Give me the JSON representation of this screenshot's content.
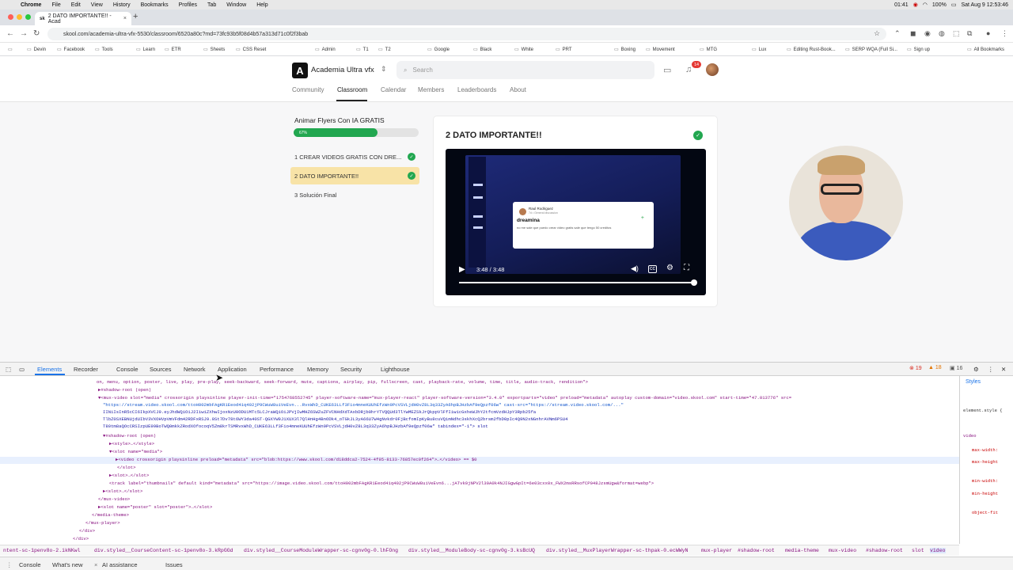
{
  "menubar": {
    "app": "Chrome",
    "items": [
      "File",
      "Edit",
      "View",
      "History",
      "Bookmarks",
      "Profiles",
      "Tab",
      "Window",
      "Help"
    ],
    "clock": "Sat Aug 9  12:53:46",
    "battery": "100%",
    "time_small": "01:41"
  },
  "browser": {
    "tab_title": "2 DATO IMPORTANTE!! - Acad",
    "url": "skool.com/academia-ultra-vfx-5530/classroom/6520a80c?md=73fc93b5f08d4b57a313d71c0f2f3bab",
    "bookmarks": [
      "Devin",
      "Facebook",
      "Tools",
      "Learn",
      "ETR",
      "Sheets",
      "CSS Reset",
      "Admin",
      "T1",
      "T2",
      "Google",
      "Black",
      "White",
      "PRT",
      "Boxing",
      "Movement",
      "MTG",
      "Lux",
      "Editing Rust-Book...",
      "SERP WQA (Full Si...",
      "Sign up",
      "All Bookmarks"
    ]
  },
  "header": {
    "logo_letter": "A",
    "brand": "Academia Ultra vfx",
    "search_placeholder": "Search",
    "notif_count": "14",
    "nav": [
      "Community",
      "Classroom",
      "Calendar",
      "Members",
      "Leaderboards",
      "About"
    ]
  },
  "course": {
    "title": "Animar Flyers Con IA GRATIS",
    "progress_pct": 67,
    "progress_label": "67%",
    "lessons": [
      {
        "label": "1 CREAR VIDEOS GRATIS CON DRE...",
        "done": true
      },
      {
        "label": "2 DATO IMPORTANTE!!",
        "done": true
      },
      {
        "label": "3 Solución Final",
        "done": false
      }
    ]
  },
  "lesson": {
    "title": "2 DATO IMPORTANTE!!",
    "time": "3:48 / 3:48",
    "card_name": "Raul Rodriguez",
    "card_sub": "7d • General discussion",
    "card_heading": "dreamina",
    "card_body": "no me sale que puedo crear video gratis sale que tengo 50 creditos"
  },
  "devtools": {
    "tabs": [
      "Elements",
      "Recorder",
      "Console",
      "Sources",
      "Network",
      "Application",
      "Performance",
      "Memory",
      "Security",
      "Lighthouse"
    ],
    "errors": "19",
    "warnings": "18",
    "infos": "16",
    "code_lines": [
      "on, menu, option, poster, live, play, pre-play, seek-backward, seek-forward, mute, captions, airplay, pip, fullscreen, cast, playback-rate, volume, time, title, audio-track, rendition\">",
      "▶#shadow-root (open)",
      "▼<mux-video slot=\"media\" crossorigin playsinline player-init-time=\"1754768552745\" player-software-name=\"mux-player-react\" player-software-version=\"3.4.0\" exportparts=\"video\" preload=\"metadata\" autoplay custom-domain=\"video.skool.com\" start-time=\"47.013776\" src=",
      "\"https://stream.video.skool.com/ttoH002mbFAgKR1Eeod41q402jP9CWuW8uiVeEvn...RvxWhD_CUKE63LLf3Fio4mneKUUhEfzWn9PcVSVLjdH0vZ8L3q33ZyA6hpBJHzbAf9eQpzf06w\" cast-src=\"https://stream.video.skool.com/...\"",
      "IINiIsInR5cCI6IkpXVCJ9.eyJhdWQiOiJ2IiwiZXhwIjoxNzU0ODU1MTc5LCJraWQiOiJPVjIwMHZ6SWZuZFVCNHdXdTAxbDRjb0hrYTVQQUd3TlYwMEZSkJrQkppVlFfIiwicGxheWJhY2tfcmVzdHJpY3Rpb25fa",
      "TlbZ0SXEBNUjdUIbV3VXOHVpVmVFdm42RDFxRSJ9.0St7Dv78t6WY3da40ST-QGXYW9J1XUX3l7QlHnHg4BnODk4_oTGkJL3yA66U7W4gNvkdr0FjBcfomIpKyBu8cuVQimNdhc3skhXcQ2brsm2fbD0pIc4Q9N2xNGnhrAVNm6PSU4",
      "T80tm8aQOcCRSIzpUE99BoTWQ0mkkZRodXOfocoqV5Zm8krTSMRvxWhD_CUKE63LLf3Fio4mneKUUhEfzWn9PcVSVLjdH0vZ8L3q33ZyA6hpBJHzbAf9eQpzf06w\" tabindex=\"-1\"> slot",
      "▼#shadow-root (open)",
      "▶<style>…</style>",
      "▼<slot name=\"media\">",
      "▶<video crossorigin playsinline preload=\"metadata\" src=\"blob:https://www.skool.com/d18ddca2-7524-4f95-8133-76857ec0f264\">…</video> == $0",
      "</slot>",
      "▶<slot>…</slot>",
      "<track label=\"thumbnails\" default kind=\"metadata\" src=\"https://image.video.skool.com/ttoH002mbFAgKR1Eeod41q402jP9CWuW8uiVeEvn6...jATvk9jNPV2l30A0k4NJIGgwGpIt=6e03cxx0x_FWX2msRRsofCP048JzsmUgw&format=webp\">",
      "▶<slot>…</slot>",
      "</mux-video>",
      "▶<slot name=\"poster\" slot=\"poster\">…</slot>",
      "</media-theme>",
      "</mux-player>",
      "</div>",
      "</div>"
    ],
    "styles_tab": "Styles",
    "breadcrumbs": [
      "ntent-sc-1penv8o-2.ikNKwl",
      "div.styled__CourseContent-sc-1penv8o-3.kRpGGd",
      "div.styled__CourseModuleWrapper-sc-cgnv0g-0.lhFOng",
      "div.styled__ModuleBody-sc-cgnv0g-3.ksBcUQ",
      "div.styled__MuxPlayerWrapper-sc-thpak-0.ecWWyN",
      "mux-player",
      "#shadow-root",
      "media-theme",
      "mux-video",
      "#shadow-root",
      "slot",
      "video"
    ],
    "drawer": [
      "Console",
      "What's new",
      "AI assistance",
      "Issues"
    ]
  }
}
